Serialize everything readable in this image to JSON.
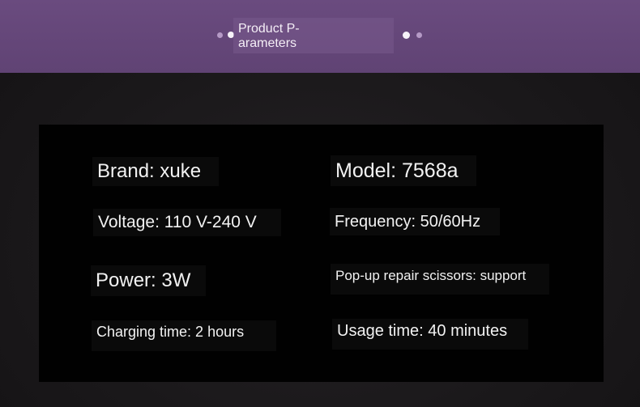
{
  "header": {
    "title": "Product P-\narameters",
    "accent_color": "#6a4b7f"
  },
  "specs": {
    "brand": "Brand: xuke",
    "model": "Model: 7568a",
    "voltage": "Voltage: 110 V-240 V",
    "frequency": "Frequency: 50/60Hz",
    "power": "Power: 3W",
    "scissors": "Pop-up repair scissors: support",
    "charging": "Charging time: 2 hours",
    "usage": "Usage time: 40 minutes"
  }
}
